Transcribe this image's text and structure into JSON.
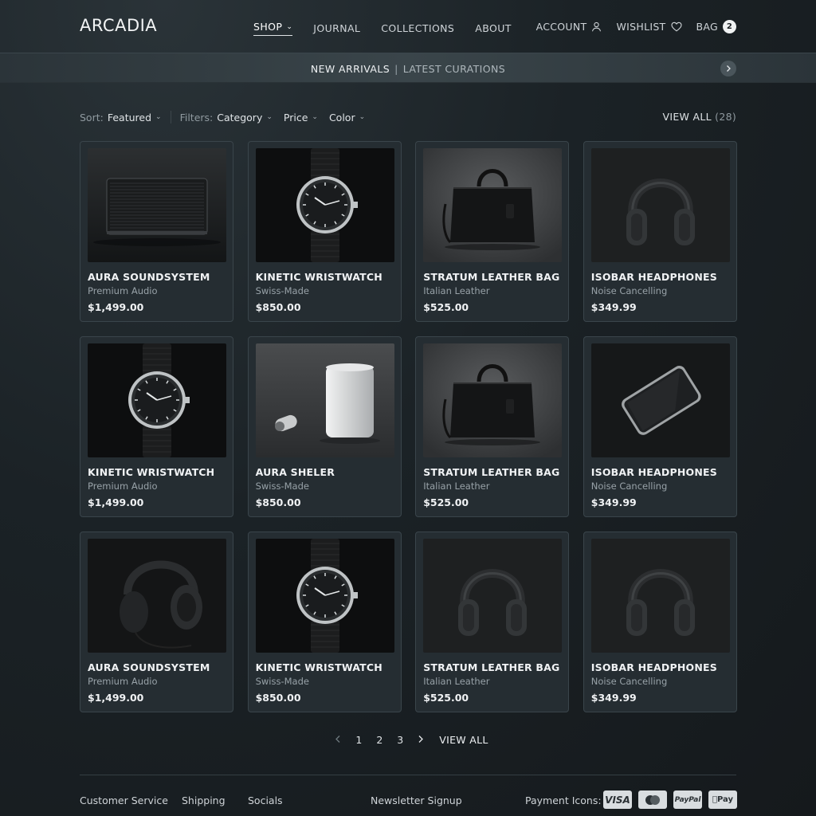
{
  "header": {
    "brand": "ARCADIA",
    "nav": [
      {
        "label": "SHOP",
        "active": true
      },
      {
        "label": "JOURNAL"
      },
      {
        "label": "COLLECTIONS"
      },
      {
        "label": "ABOUT"
      }
    ],
    "account_label": "ACCOUNT",
    "wishlist_label": "WISHLIST",
    "bag_label": "BAG",
    "bag_count": "2"
  },
  "banner": {
    "main": "NEW ARRIVALS",
    "separator": "|",
    "sub": "LATEST CURATIONS"
  },
  "filters": {
    "sort_label": "Sort:",
    "sort_value": "Featured",
    "filters_label": "Filters:",
    "category": "Category",
    "price": "Price",
    "color": "Color",
    "view_all": "VIEW ALL",
    "view_all_count": "(28)"
  },
  "products": [
    {
      "name": "AURA SOUNDSYSTEM",
      "sub": "Premium Audio",
      "price": "$1,499.00",
      "image": "speaker"
    },
    {
      "name": "KINETIC WRISTWATCH",
      "sub": "Swiss-Made",
      "price": "$850.00",
      "image": "watch"
    },
    {
      "name": "STRATUM LEATHER BAG",
      "sub": "Italian Leather",
      "price": "$525.00",
      "image": "bag"
    },
    {
      "name": "ISOBAR HEADPHONES",
      "sub": "Noise Cancelling",
      "price": "$349.99",
      "image": "headphones"
    },
    {
      "name": "KINETIC WRISTWATCH",
      "sub": "Premium Audio",
      "price": "$1,499.00",
      "image": "watch"
    },
    {
      "name": "AURA SHELER",
      "sub": "Swiss-Made",
      "price": "$850.00",
      "image": "cylinder"
    },
    {
      "name": "STRATUM LEATHER BAG",
      "sub": "Italian Leather",
      "price": "$525.00",
      "image": "bag"
    },
    {
      "name": "ISOBAR HEADPHONES",
      "sub": "Noise Cancelling",
      "price": "$349.99",
      "image": "phone"
    },
    {
      "name": "AURA SOUNDSYSTEM",
      "sub": "Premium Audio",
      "price": "$1,499.00",
      "image": "headphones-side"
    },
    {
      "name": "KINETIC WRISTWATCH",
      "sub": "Swiss-Made",
      "price": "$850.00",
      "image": "watch"
    },
    {
      "name": "STRATUM LEATHER BAG",
      "sub": "Italian Leather",
      "price": "$525.00",
      "image": "headphones"
    },
    {
      "name": "ISOBAR HEADPHONES",
      "sub": "Noise Cancelling",
      "price": "$349.99",
      "image": "headphones"
    }
  ],
  "pagination": {
    "prev_icon": "chevron-left-icon",
    "pages": [
      "1",
      "2",
      "3"
    ],
    "next_icon": "chevron-right-icon",
    "view_all": "VIEW ALL"
  },
  "footer": {
    "links": [
      "Customer Service",
      "Shipping",
      "Socials",
      "Newsletter Signup"
    ],
    "payment_label": "Payment Icons:",
    "payment_methods": [
      "VISA",
      "Mastercard",
      "PayPal",
      "Apple Pay"
    ]
  }
}
